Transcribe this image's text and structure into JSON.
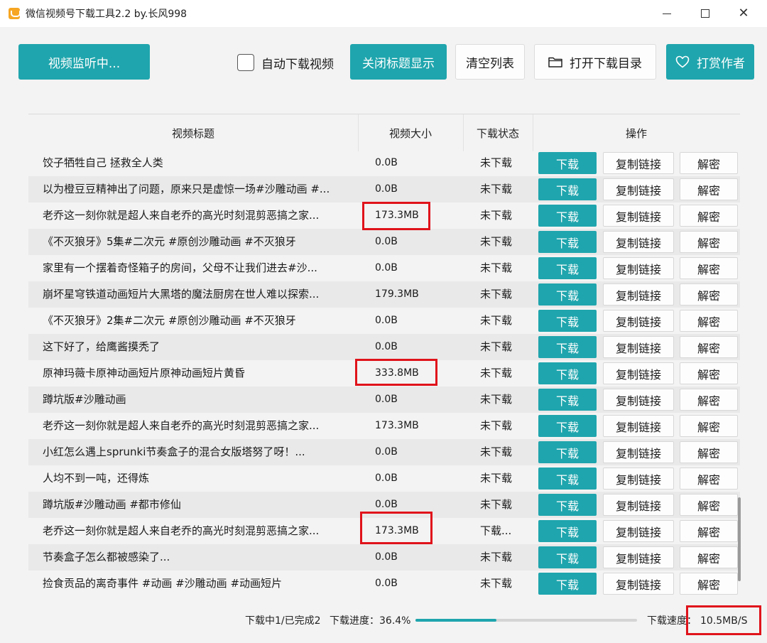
{
  "window": {
    "title": "微信视频号下载工具2.2 by.长风998",
    "icon": "app-logo-icon"
  },
  "toolbar": {
    "monitor_label": "视频监听中...",
    "auto_download_label": "自动下载视频",
    "auto_download_checked": false,
    "close_title_label": "关闭标题显示",
    "clear_list_label": "清空列表",
    "open_dir_label": "打开下载目录",
    "open_dir_icon": "folder-icon",
    "tip_author_label": "打赏作者",
    "tip_author_icon": "heart-icon"
  },
  "table": {
    "headers": [
      "视频标题",
      "视频大小",
      "下载状态",
      "操作"
    ],
    "action_labels": {
      "download": "下载",
      "copy": "复制链接",
      "decrypt": "解密"
    },
    "rows": [
      {
        "title": "饺子牺牲自己 拯救全人类",
        "size": "0.0B",
        "status": "未下载"
      },
      {
        "title": "以为橙豆豆精神出了问题，原来只是虚惊一场#沙雕动画 #...",
        "size": "0.0B",
        "status": "未下载"
      },
      {
        "title": "老乔这一刻你就是超人来自老乔的高光时刻混剪恶搞之家...",
        "size": "173.3MB",
        "status": "未下载"
      },
      {
        "title": "《不灭狼牙》5集#二次元 #原创沙雕动画 #不灭狼牙",
        "size": "0.0B",
        "status": "未下载"
      },
      {
        "title": "家里有一个摆着奇怪箱子的房间，父母不让我们进去#沙...",
        "size": "0.0B",
        "status": "未下载"
      },
      {
        "title": "崩坏星穹铁道动画短片大黑塔的魔法厨房在世人难以探索...",
        "size": "179.3MB",
        "status": "未下载"
      },
      {
        "title": "《不灭狼牙》2集#二次元 #原创沙雕动画 #不灭狼牙",
        "size": "0.0B",
        "status": "未下载"
      },
      {
        "title": "这下好了，给鹰酱摸秃了",
        "size": "0.0B",
        "status": "未下载"
      },
      {
        "title": "原神玛薇卡原神动画短片原神动画短片黄昏",
        "size": "333.8MB",
        "status": "未下载"
      },
      {
        "title": "蹲坑版#沙雕动画",
        "size": "0.0B",
        "status": "未下载"
      },
      {
        "title": "老乔这一刻你就是超人来自老乔的高光时刻混剪恶搞之家...",
        "size": "173.3MB",
        "status": "未下载"
      },
      {
        "title": "小红怎么遇上sprunki节奏盒子的混合女版塔努了呀！...",
        "size": "0.0B",
        "status": "未下载"
      },
      {
        "title": "人均不到一吨，还得炼",
        "size": "0.0B",
        "status": "未下载"
      },
      {
        "title": "蹲坑版#沙雕动画 #都市修仙",
        "size": "0.0B",
        "status": "未下载"
      },
      {
        "title": "老乔这一刻你就是超人来自老乔的高光时刻混剪恶搞之家...",
        "size": "173.3MB",
        "status": "下载..."
      },
      {
        "title": "节奏盒子怎么都被感染了...",
        "size": "0.0B",
        "status": "未下载"
      },
      {
        "title": "捡食贡品的离奇事件 #动画 #沙雕动画 #动画短片",
        "size": "0.0B",
        "status": "未下载"
      }
    ]
  },
  "status_bar": {
    "count_text": "下载中1/已完成2",
    "progress_label": "下载进度：36.4%",
    "progress_fraction": 0.364,
    "speed_label": "下载速度：",
    "speed_value": "10.5MB/S"
  },
  "colors": {
    "accent": "#1fa5ad",
    "highlight": "#e0131b"
  }
}
